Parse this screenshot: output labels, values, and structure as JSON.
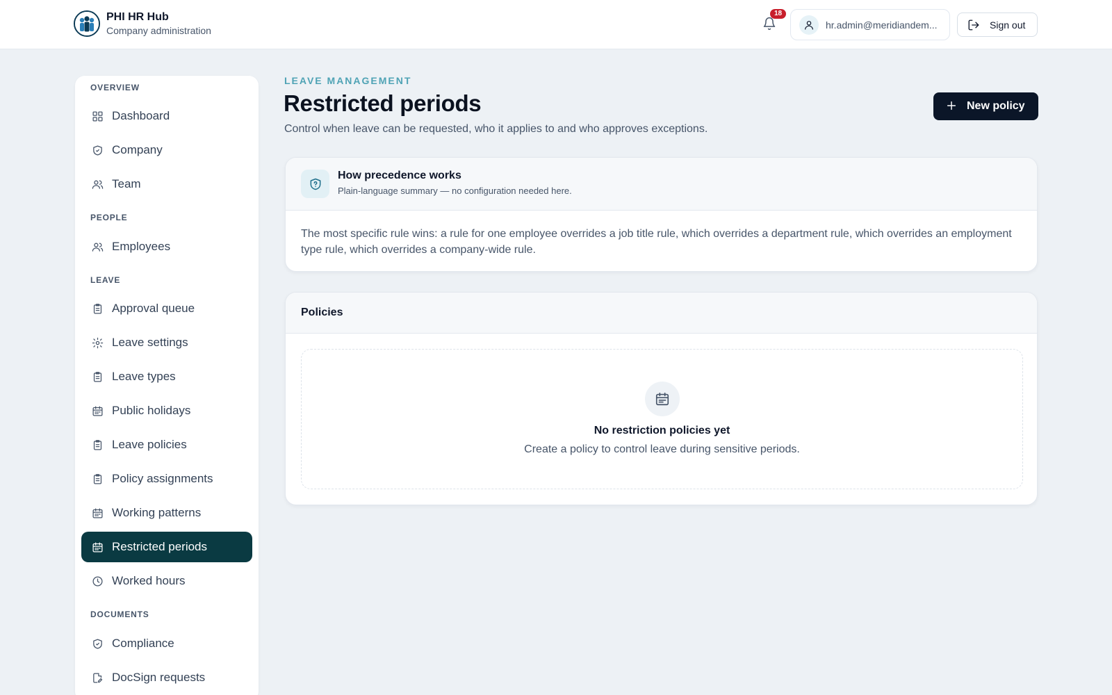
{
  "header": {
    "app_title": "PHI HR Hub",
    "app_subtitle": "Company administration",
    "notification_count": "18",
    "user_email": "hr.admin@meridiandem...",
    "sign_out_label": "Sign out"
  },
  "sidebar": {
    "sections": {
      "overview": "OVERVIEW",
      "people": "PEOPLE",
      "leave": "LEAVE",
      "documents": "DOCUMENTS"
    },
    "items": {
      "dashboard": "Dashboard",
      "company": "Company",
      "team": "Team",
      "employees": "Employees",
      "approval_queue": "Approval queue",
      "leave_settings": "Leave settings",
      "leave_types": "Leave types",
      "public_holidays": "Public holidays",
      "leave_policies": "Leave policies",
      "policy_assignments": "Policy assignments",
      "working_patterns": "Working patterns",
      "restricted_periods": "Restricted periods",
      "worked_hours": "Worked hours",
      "compliance": "Compliance",
      "docsign_requests": "DocSign requests"
    },
    "active_item": "restricted_periods"
  },
  "main": {
    "eyebrow": "LEAVE MANAGEMENT",
    "title": "Restricted periods",
    "description": "Control when leave can be requested, who it applies to and who approves exceptions.",
    "new_policy_label": "New policy",
    "precedence": {
      "title": "How precedence works",
      "subtitle": "Plain-language summary — no configuration needed here.",
      "body": "The most specific rule wins: a rule for one employee overrides a job title rule, which overrides a department rule, which overrides an employment type rule, which overrides a company-wide rule."
    },
    "policies": {
      "title": "Policies",
      "empty_title": "No restriction policies yet",
      "empty_subtitle": "Create a policy to control leave during sensitive periods."
    }
  },
  "colors": {
    "accent_dark": "#0a3a42",
    "button_dark": "#0b1628",
    "eyebrow": "#4fa3b5",
    "badge": "#c81e2b"
  }
}
